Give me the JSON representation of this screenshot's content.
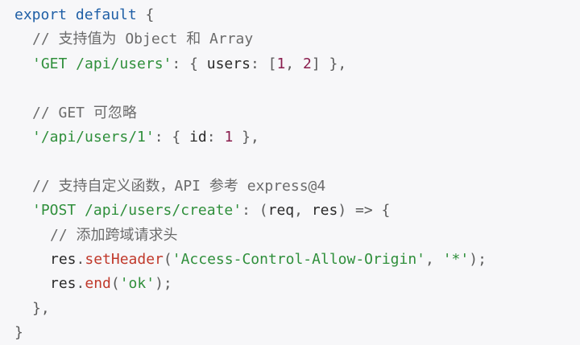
{
  "code": {
    "lines": [
      {
        "kw": "export default",
        "p": " {"
      },
      {
        "comment": "// 支持值为 Object 和 Array"
      },
      {
        "str": "'GET /api/users'",
        "p1": ": { ",
        "prop": "users",
        "p2": ": [",
        "n1": "1",
        "p3": ", ",
        "n2": "2",
        "p4": "] },"
      },
      {},
      {
        "comment": "// GET 可忽略"
      },
      {
        "str": "'/api/users/1'",
        "p1": ": { ",
        "prop": "id",
        "p2": ": ",
        "n1": "1",
        "p3": " },"
      },
      {},
      {
        "comment": "// 支持自定义函数，API 参考 express@4"
      },
      {
        "str": "'POST /api/users/create'",
        "p1": ": (",
        "a1": "req",
        "p2": ", ",
        "a2": "res",
        "p3": ") => {"
      },
      {
        "comment": "// 添加跨域请求头"
      },
      {
        "obj": "res",
        "dot": ".",
        "fn": "setHeader",
        "p1": "(",
        "s1": "'Access-Control-Allow-Origin'",
        "p2": ", ",
        "s2": "'*'",
        "p3": ");"
      },
      {
        "obj": "res",
        "dot": ".",
        "fn": "end",
        "p1": "(",
        "s1": "'ok'",
        "p2": ");"
      },
      {
        "p": "},"
      },
      {
        "p": "}"
      }
    ]
  },
  "colors": {
    "background": "#f7f7f9",
    "keyword": "#1f5fa6",
    "comment": "#6b6b6b",
    "string": "#2f8f3b",
    "number": "#8a1d4d",
    "function": "#c0392b"
  }
}
